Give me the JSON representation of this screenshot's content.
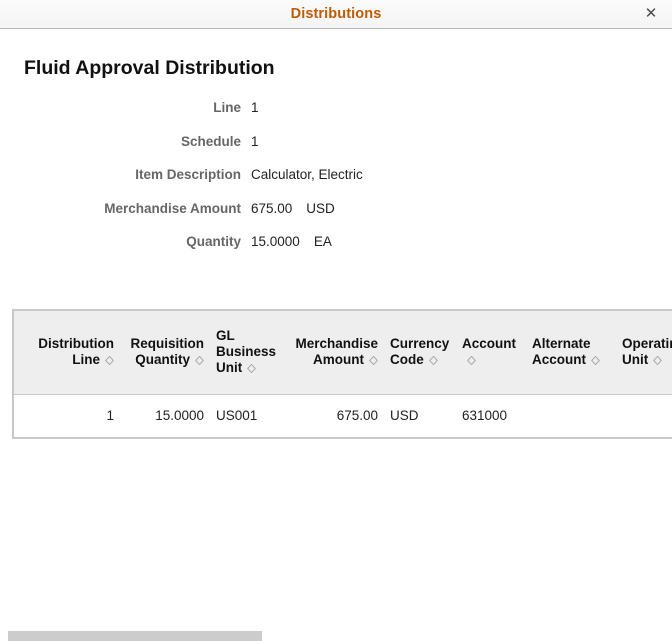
{
  "modal": {
    "title": "Distributions",
    "close_label": "✕",
    "close_icon": "close-icon"
  },
  "page": {
    "heading": "Fluid Approval Distribution"
  },
  "fields": [
    {
      "label": "Line",
      "value": "1",
      "unit": ""
    },
    {
      "label": "Schedule",
      "value": "1",
      "unit": ""
    },
    {
      "label": "Item Description",
      "value": "Calculator, Electric",
      "unit": ""
    },
    {
      "label": "Merchandise Amount",
      "value": "675.00",
      "unit": "USD"
    },
    {
      "label": "Quantity",
      "value": "15.0000",
      "unit": "EA"
    }
  ],
  "grid": {
    "sort_icon": "sort-diamond-icon",
    "columns": [
      {
        "label": "Distribution Line",
        "align": "right",
        "sortable": true
      },
      {
        "label": "Requisition Quantity",
        "align": "right",
        "sortable": true
      },
      {
        "label": "GL Business Unit",
        "align": "left",
        "sortable": true
      },
      {
        "label": "Merchandise Amount",
        "align": "right",
        "sortable": true
      },
      {
        "label": "Currency Code",
        "align": "left",
        "sortable": true
      },
      {
        "label": "Account",
        "align": "left",
        "sortable": true
      },
      {
        "label": "Alternate Account",
        "align": "left",
        "sortable": true
      },
      {
        "label": "Operating Unit",
        "align": "left",
        "sortable": true
      }
    ],
    "rows": [
      {
        "distribution_line": "1",
        "requisition_quantity": "15.0000",
        "gl_business_unit": "US001",
        "merchandise_amount": "675.00",
        "currency_code": "USD",
        "account": "631000",
        "alternate_account": "",
        "operating_unit": ""
      }
    ]
  },
  "scrollbar": {
    "orientation": "horizontal",
    "thumb_position_pct": 0,
    "thumb_width_pct": 38
  },
  "colors": {
    "title": "#bf5b04",
    "label": "#666666",
    "value": "#222222",
    "header_bg": "#eeeeee",
    "border": "#c8c8c8",
    "scroll_thumb": "#cccccc"
  }
}
